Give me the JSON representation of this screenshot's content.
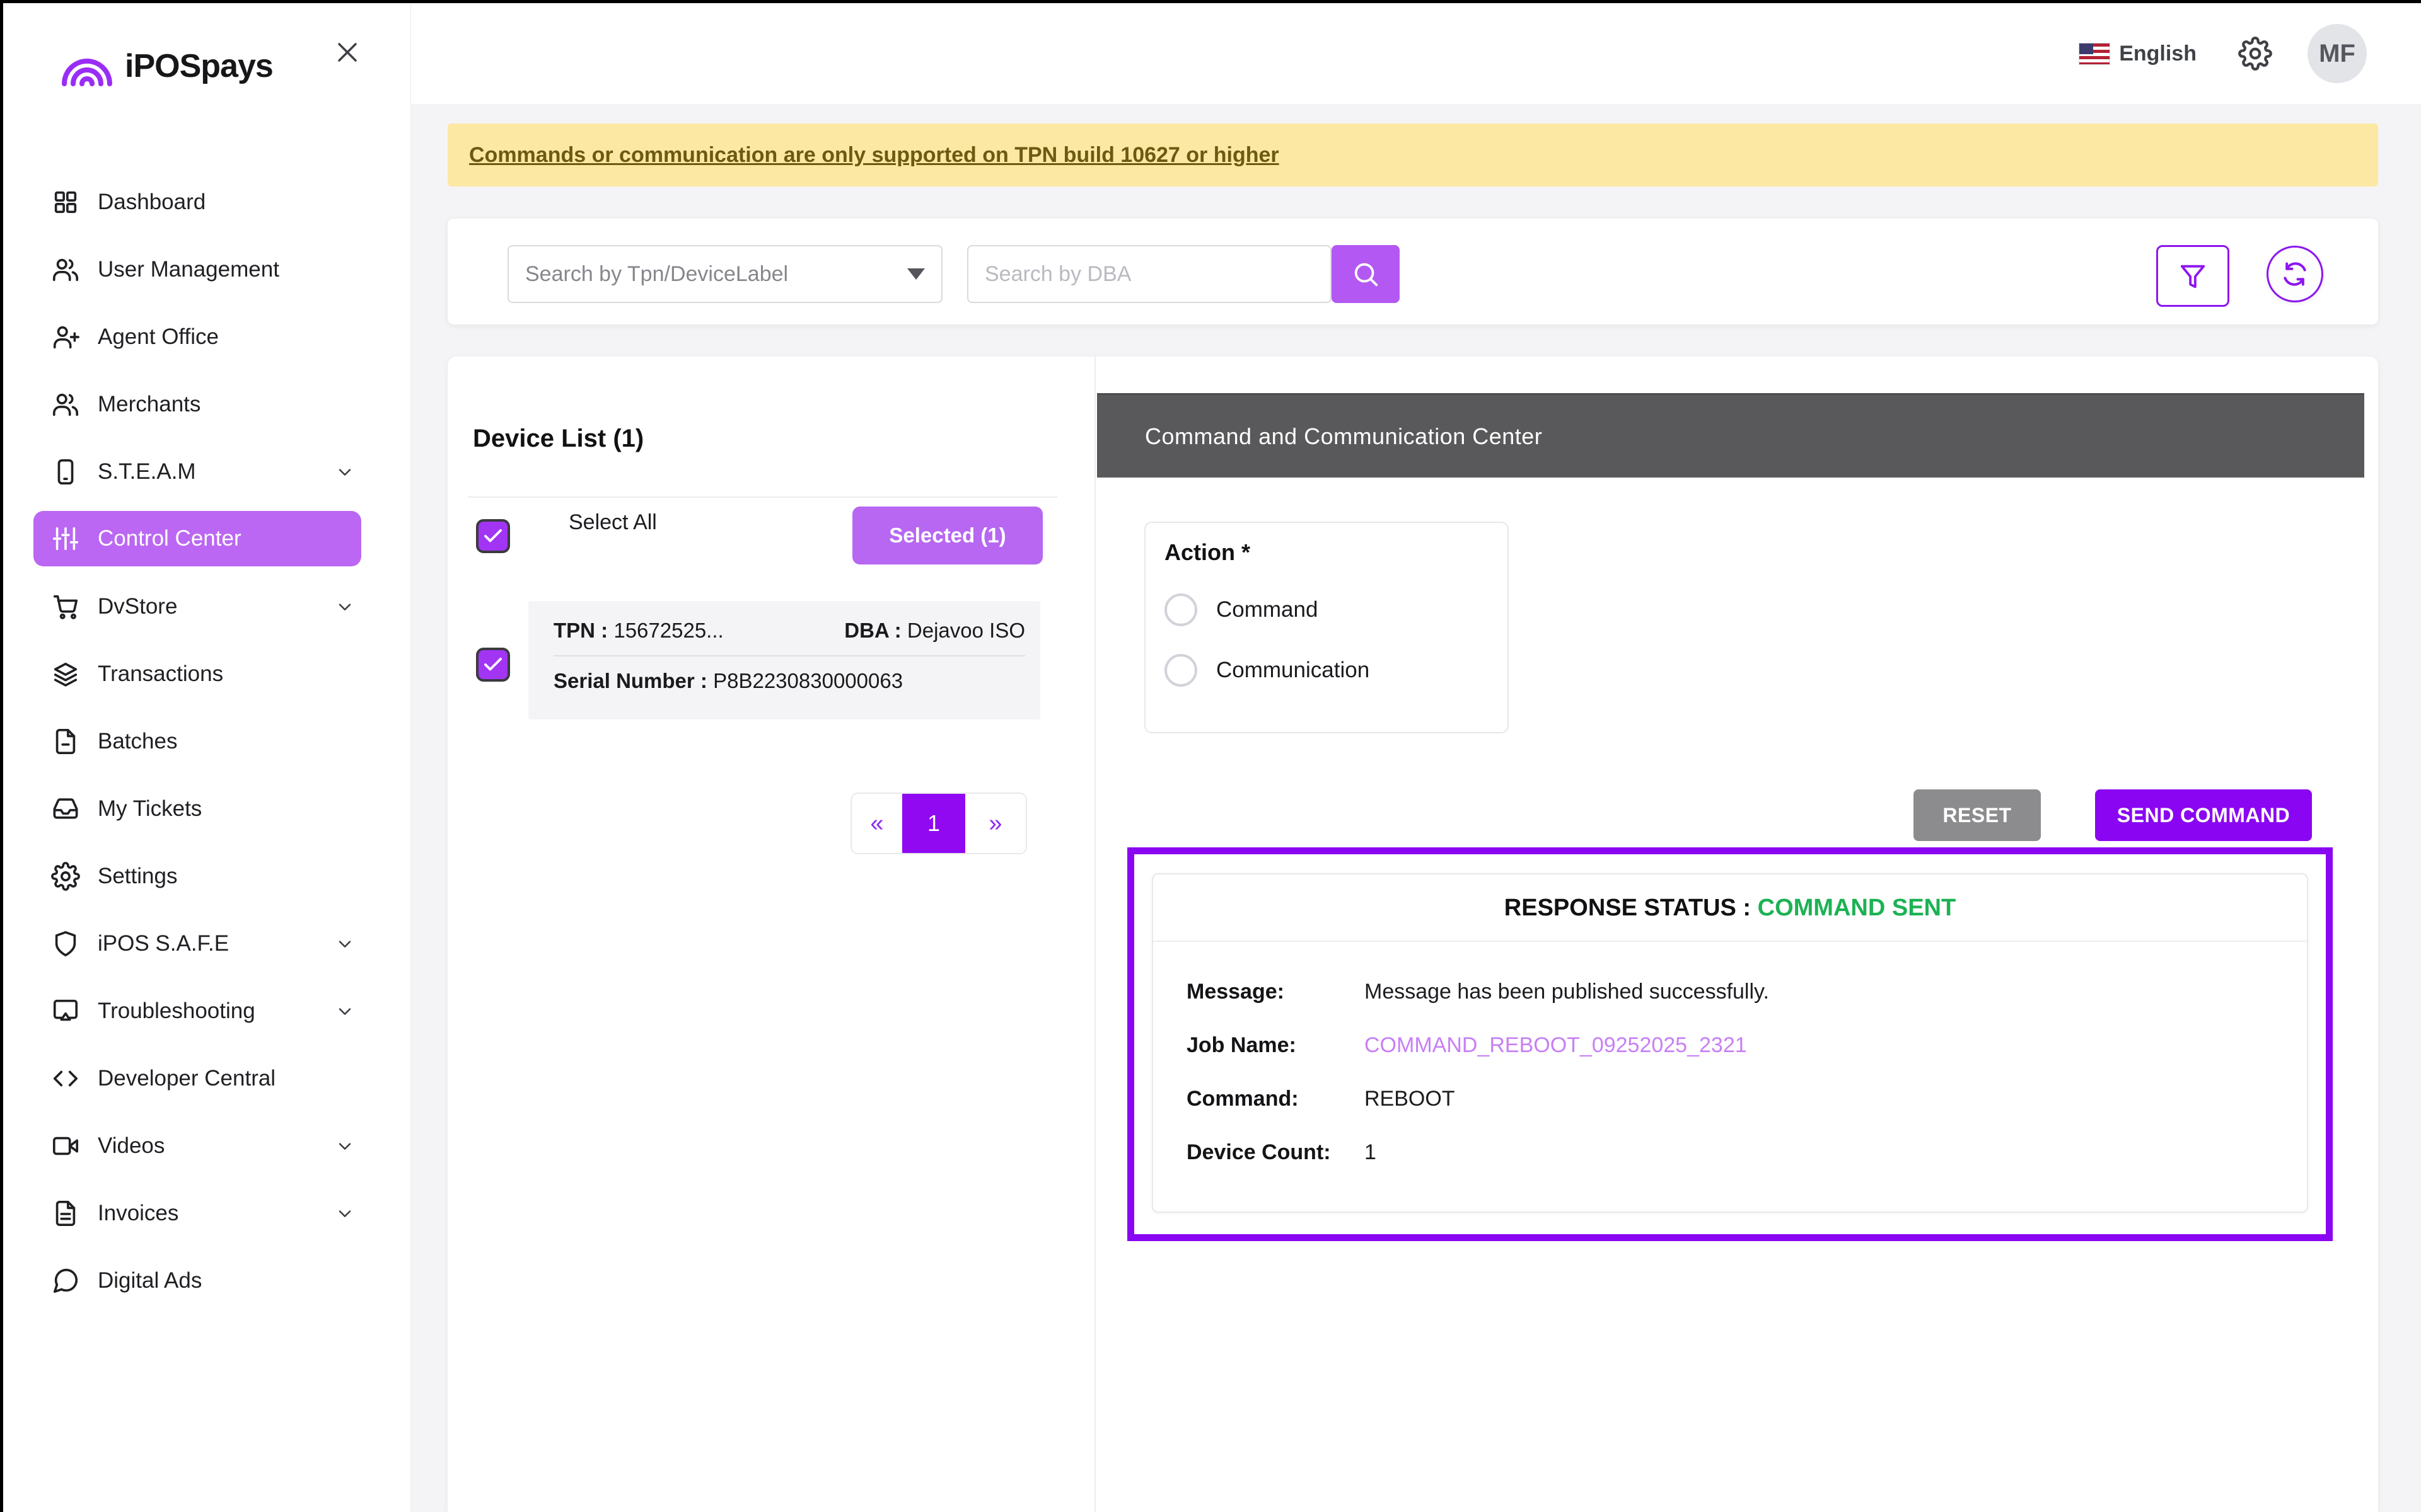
{
  "app": {
    "brand": "iPOSpays"
  },
  "topbar": {
    "language": "English",
    "avatar_initials": "MF"
  },
  "banner": {
    "text": "Commands or communication are only supported on TPN build 10627 or higher"
  },
  "search": {
    "dropdown_label": "Search by Tpn/DeviceLabel",
    "dba_placeholder": "Search by DBA"
  },
  "sidebar": {
    "items": [
      {
        "label": "Dashboard",
        "icon": "dashboard-icon",
        "expandable": false,
        "active": false
      },
      {
        "label": "User Management",
        "icon": "users-icon",
        "expandable": false,
        "active": false
      },
      {
        "label": "Agent Office",
        "icon": "user-plus-icon",
        "expandable": false,
        "active": false
      },
      {
        "label": "Merchants",
        "icon": "users-icon",
        "expandable": false,
        "active": false
      },
      {
        "label": "S.T.E.A.M",
        "icon": "smartphone-icon",
        "expandable": true,
        "active": false
      },
      {
        "label": "Control Center",
        "icon": "sliders-icon",
        "expandable": false,
        "active": true
      },
      {
        "label": "DvStore",
        "icon": "cart-icon",
        "expandable": true,
        "active": false
      },
      {
        "label": "Transactions",
        "icon": "layers-icon",
        "expandable": false,
        "active": false
      },
      {
        "label": "Batches",
        "icon": "file-minus-icon",
        "expandable": false,
        "active": false
      },
      {
        "label": "My Tickets",
        "icon": "inbox-icon",
        "expandable": false,
        "active": false
      },
      {
        "label": "Settings",
        "icon": "gear-icon",
        "expandable": false,
        "active": false
      },
      {
        "label": "iPOS S.A.F.E",
        "icon": "shield-icon",
        "expandable": true,
        "active": false
      },
      {
        "label": "Troubleshooting",
        "icon": "screen-share-icon",
        "expandable": true,
        "active": false
      },
      {
        "label": "Developer Central",
        "icon": "code-icon",
        "expandable": false,
        "active": false
      },
      {
        "label": "Videos",
        "icon": "video-icon",
        "expandable": true,
        "active": false
      },
      {
        "label": "Invoices",
        "icon": "invoice-icon",
        "expandable": true,
        "active": false
      },
      {
        "label": "Digital Ads",
        "icon": "chat-icon",
        "expandable": false,
        "active": false
      }
    ]
  },
  "device_list": {
    "title": "Device List (1)",
    "select_all_label": "Select All",
    "selected_button": "Selected (1)",
    "device": {
      "tpn_label": "TPN :",
      "tpn_value": "15672525...",
      "dba_label": "DBA :",
      "dba_value": "Dejavoo ISO",
      "serial_label": "Serial Number :",
      "serial_value": "P8B2230830000063"
    },
    "pagination": {
      "prev": "«",
      "page": "1",
      "next": "»"
    }
  },
  "command_center": {
    "header": "Command and Communication Center",
    "action_label": "Action *",
    "options": [
      {
        "label": "Command"
      },
      {
        "label": "Communication"
      }
    ],
    "reset_button": "RESET",
    "send_button": "SEND COMMAND"
  },
  "response": {
    "status_label": "RESPONSE STATUS :",
    "status_value": "COMMAND SENT",
    "rows": [
      {
        "label": "Message:",
        "value": "Message has been published successfully."
      },
      {
        "label": "Job Name:",
        "value": "COMMAND_REBOOT_09252025_2321"
      },
      {
        "label": "Command:",
        "value": "REBOOT"
      },
      {
        "label": "Device Count:",
        "value": "1"
      }
    ]
  },
  "colors": {
    "accent_deep": "#8A06F2",
    "accent_light": "#BB67F3",
    "success_green": "#1CB254",
    "banner_bg": "#FCE8A3",
    "banner_text": "#6D5A10",
    "panel_header_bg": "#59595B",
    "link_purple": "#C87FF5"
  }
}
